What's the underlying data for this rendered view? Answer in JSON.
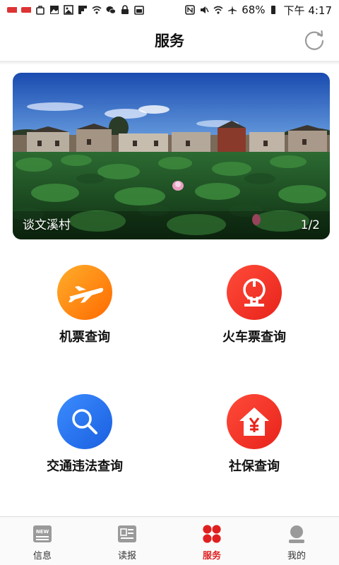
{
  "status_bar": {
    "battery": "68%",
    "time": "下午 4:17"
  },
  "header": {
    "title": "服务"
  },
  "banner": {
    "caption": "谈文溪村",
    "page_indicator": "1/2"
  },
  "services": [
    {
      "label": "机票查询",
      "icon": "airplane-icon",
      "color": "#ff7a10"
    },
    {
      "label": "火车票查询",
      "icon": "railway-icon",
      "color": "#ee2b1e"
    },
    {
      "label": "交通违法查询",
      "icon": "search-icon",
      "color": "#1f6fe8"
    },
    {
      "label": "社保查询",
      "icon": "yuan-house-icon",
      "color": "#ee2b1e"
    }
  ],
  "bottom_nav": {
    "items": [
      {
        "label": "信息",
        "icon": "news-icon"
      },
      {
        "label": "读报",
        "icon": "newspaper-icon"
      },
      {
        "label": "服务",
        "icon": "services-dots-icon",
        "active": true
      },
      {
        "label": "我的",
        "icon": "profile-icon"
      }
    ]
  },
  "colors": {
    "accent": "#e02020",
    "nav_inactive": "#9a9a9a"
  }
}
